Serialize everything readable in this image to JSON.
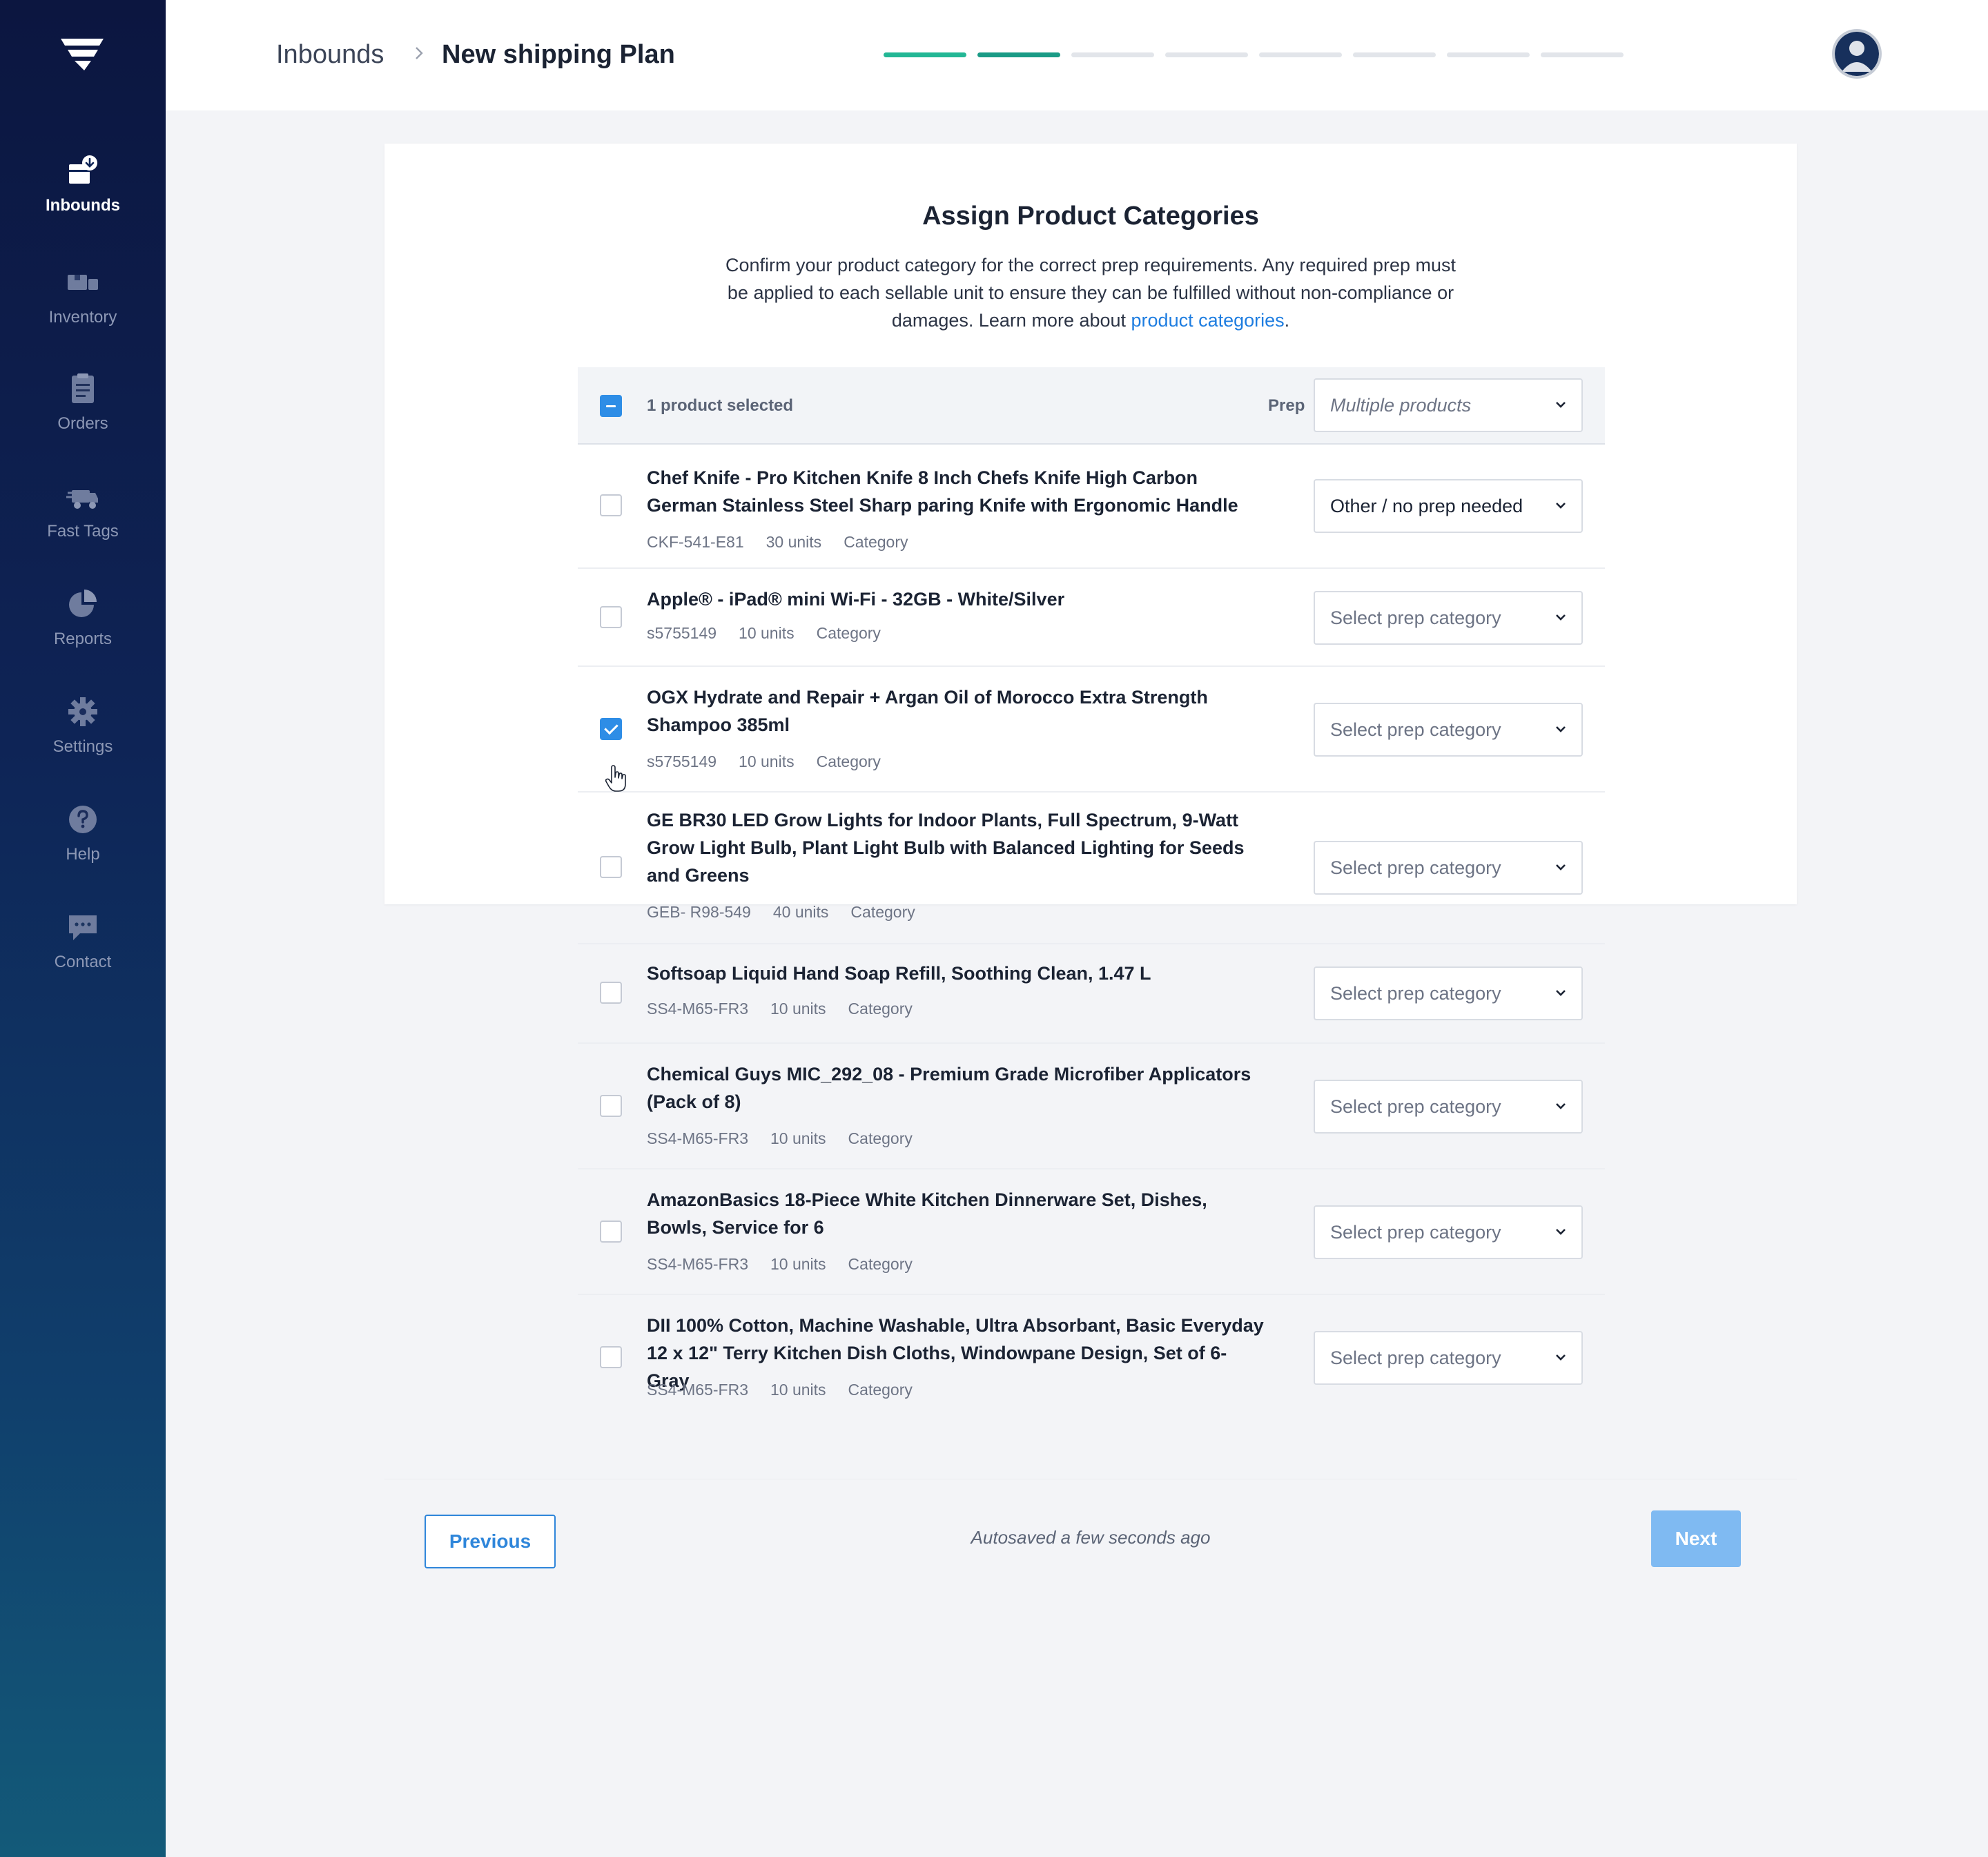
{
  "sidebar": {
    "logo_icon": "brand-logo-icon",
    "items": [
      {
        "label": "Inbounds",
        "icon": "inbounds-icon",
        "active": true
      },
      {
        "label": "Inventory",
        "icon": "inventory-icon"
      },
      {
        "label": "Orders",
        "icon": "orders-icon"
      },
      {
        "label": "Fast Tags",
        "icon": "fast-tags-icon"
      },
      {
        "label": "Reports",
        "icon": "reports-icon"
      },
      {
        "label": "Settings",
        "icon": "settings-icon"
      },
      {
        "label": "Help",
        "icon": "help-icon"
      },
      {
        "label": "Contact",
        "icon": "contact-icon"
      }
    ]
  },
  "header": {
    "breadcrumb_root": "Inbounds",
    "breadcrumb_current": "New shipping Plan",
    "progress": {
      "steps_total": 8,
      "steps_completed": 2
    },
    "avatar_icon": "user-avatar-icon"
  },
  "main": {
    "title": "Assign Product Categories",
    "description_pre": "Confirm your product category for the correct prep requirements. Any required prep must be applied to each sellable unit to ensure they can be fulfilled without non-compliance or damages. Learn more about ",
    "description_link": "product categories",
    "description_post": ".",
    "table_header": {
      "selected_text": "1 product selected",
      "prep_label": "Prep",
      "bulk_select_value": "Multiple products"
    },
    "products": [
      {
        "name": "Chef Knife - Pro Kitchen Knife 8 Inch Chefs Knife High Carbon German Stainless Steel Sharp paring Knife with Ergonomic Handle",
        "sku": "CKF-541-E81",
        "units": "30 units",
        "category": "Category",
        "prep": "Other / no prep needed",
        "checked": false
      },
      {
        "name": "Apple® - iPad® mini Wi-Fi - 32GB - White/Silver",
        "sku": "s5755149",
        "units": "10 units",
        "category": "Category",
        "prep": "Select prep category",
        "checked": false
      },
      {
        "name": "OGX Hydrate and Repair + Argan Oil of Morocco Extra Strength Shampoo 385ml",
        "sku": "s5755149",
        "units": "10 units",
        "category": "Category",
        "prep": "Select prep category",
        "checked": true
      },
      {
        "name": "GE BR30 LED Grow Lights for Indoor Plants, Full Spectrum, 9-Watt Grow Light Bulb, Plant Light Bulb with Balanced Lighting for Seeds and Greens",
        "sku": "GEB- R98-549",
        "units": "40 units",
        "category": "Category",
        "prep": "Select prep category",
        "checked": false
      },
      {
        "name": "Softsoap Liquid Hand Soap Refill, Soothing Clean, 1.47 L",
        "sku": "SS4-M65-FR3",
        "units": "10 units",
        "category": "Category",
        "prep": "Select prep category",
        "checked": false
      },
      {
        "name": "Chemical Guys MIC_292_08 - Premium Grade Microfiber Applicators (Pack of 8)",
        "sku": "SS4-M65-FR3",
        "units": "10 units",
        "category": "Category",
        "prep": "Select prep category",
        "checked": false
      },
      {
        "name": "AmazonBasics 18-Piece White Kitchen Dinnerware Set, Dishes, Bowls, Service for 6",
        "sku": "SS4-M65-FR3",
        "units": "10 units",
        "category": "Category",
        "prep": "Select prep category",
        "checked": false
      },
      {
        "name": "DII 100% Cotton, Machine Washable, Ultra Absorbant, Basic Everyday 12 x 12\" Terry Kitchen Dish Cloths, Windowpane Design, Set of 6- Gray",
        "sku": "SS4-M65-FR3",
        "units": "10 units",
        "category": "Category",
        "prep": "Select prep category",
        "checked": false
      }
    ]
  },
  "footer": {
    "previous_label": "Previous",
    "autosave_text": "Autosaved a few seconds ago",
    "next_label": "Next"
  },
  "colors": {
    "accent": "#2e8de6",
    "progress_done": "#23b795",
    "next_disabled": "#7fbaf2",
    "sidebar_top": "#0c1640",
    "sidebar_bottom": "#135a79"
  }
}
